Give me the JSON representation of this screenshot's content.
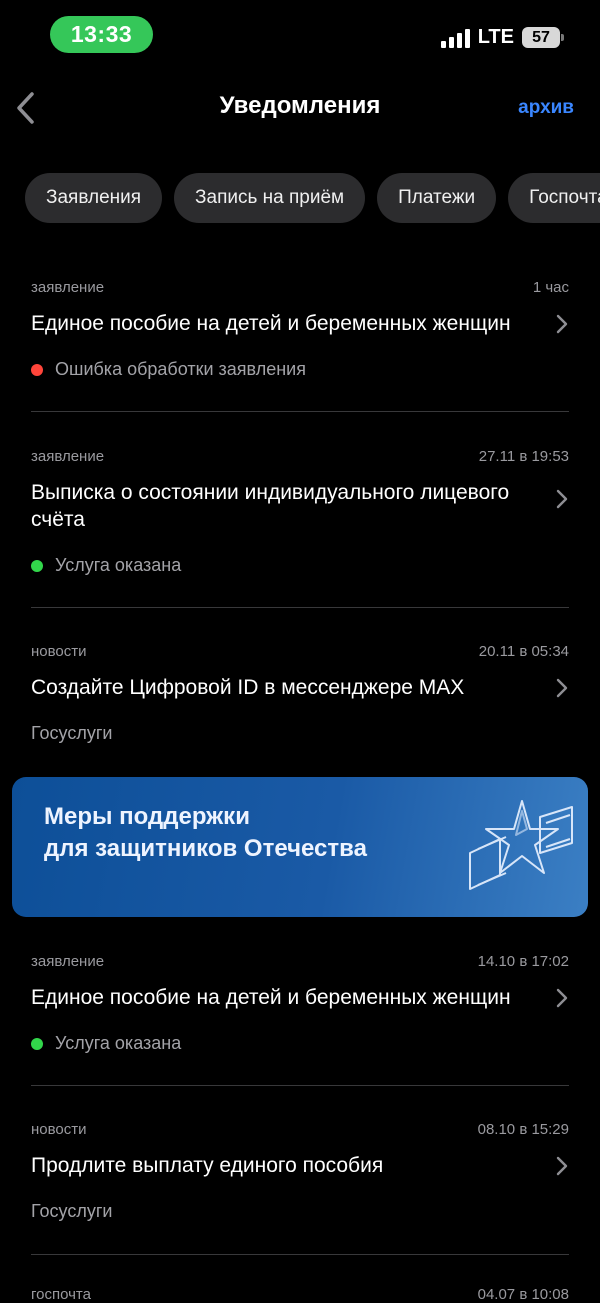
{
  "status_bar": {
    "time": "13:33",
    "network": "LTE",
    "battery": "57"
  },
  "header": {
    "title": "Уведомления",
    "archive_label": "архив",
    "back_icon": "chevron-left-icon"
  },
  "chips": [
    "Заявления",
    "Запись на приём",
    "Платежи",
    "Госпочта"
  ],
  "notifications": [
    {
      "category": "заявление",
      "time": "1 час",
      "title": "Единое пособие на детей и беременных женщин",
      "status": "Ошибка обработки заявления",
      "status_color": "#ff453a"
    },
    {
      "category": "заявление",
      "time": "27.11 в 19:53",
      "title": "Выписка о состоянии индивидуального лицевого счёта",
      "status": "Услуга оказана",
      "status_color": "#32d74b"
    },
    {
      "category": "новости",
      "time": "20.11 в 05:34",
      "title": "Создайте Цифровой ID в мессенджере MAX",
      "source": "Госуслуги"
    },
    {
      "category": "заявление",
      "time": "14.10 в 17:02",
      "title": "Единое пособие на детей и беременных женщин",
      "status": "Услуга оказана",
      "status_color": "#32d74b"
    },
    {
      "category": "новости",
      "time": "08.10 в 15:29",
      "title": "Продлите выплату единого пособия",
      "source": "Госуслуги"
    },
    {
      "category": "госпочта",
      "time": "04.07 в 10:08"
    }
  ],
  "banner": {
    "line1": "Меры поддержки",
    "line2": "для защитников Отечества",
    "icon": "star-flag-icon"
  },
  "colors": {
    "accent": "#3a86ff",
    "chip_bg": "#2c2c2e",
    "status_pill": "#35c759"
  }
}
